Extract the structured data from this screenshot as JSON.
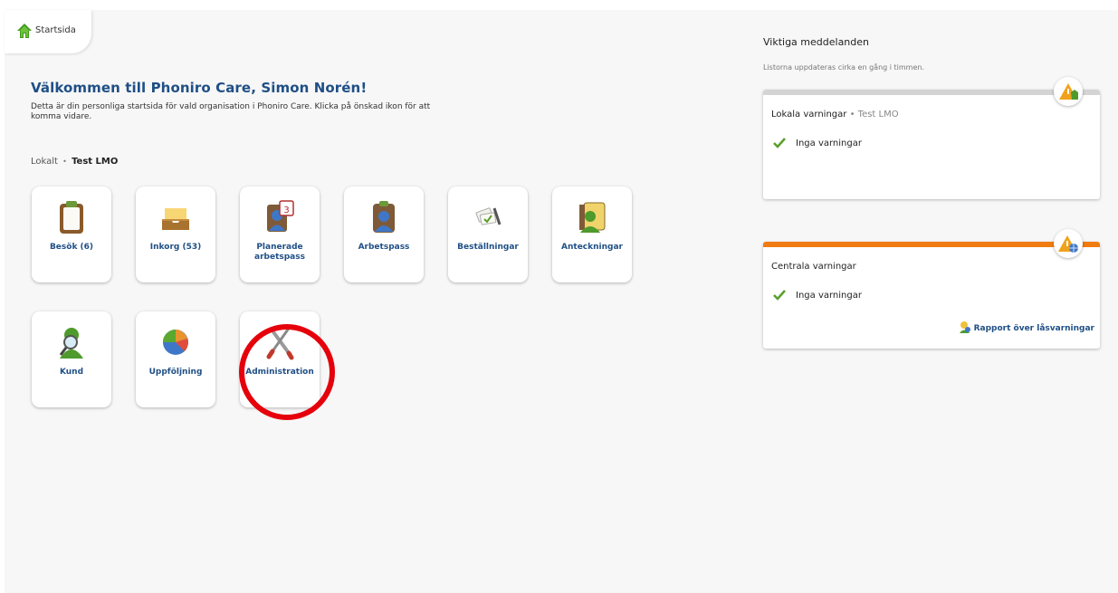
{
  "nav": {
    "start_tab": "Startsida"
  },
  "welcome": {
    "title": "Välkommen till Phoniro Care, Simon Norén!",
    "description": "Detta är din personliga startsida för vald organisation i Phoniro Care. Klicka på önskad ikon för att komma vidare."
  },
  "org": {
    "prefix": "Lokalt",
    "separator": "•",
    "name": "Test LMO"
  },
  "tiles": [
    {
      "label": "Besök (6)",
      "icon": "clipboard-icon"
    },
    {
      "label": "Inkorg (53)",
      "icon": "inbox-tray-icon"
    },
    {
      "label": "Planerade arbetspass",
      "icon": "calendar-person-icon"
    },
    {
      "label": "Arbetspass",
      "icon": "person-clipboard-icon"
    },
    {
      "label": "Beställningar",
      "icon": "order-cards-icon"
    },
    {
      "label": "Anteckningar",
      "icon": "notes-person-icon"
    },
    {
      "label": "Kund",
      "icon": "customer-search-icon"
    },
    {
      "label": "Uppföljning",
      "icon": "pie-chart-icon"
    },
    {
      "label": "Administration",
      "icon": "tools-icon"
    }
  ],
  "highlight": {
    "target": "Administration",
    "color": "#e6000b"
  },
  "messages": {
    "title": "Viktiga meddelanden",
    "subtitle": "Listorna uppdateras cirka en gång i timmen.",
    "local": {
      "title": "Lokala varningar",
      "separator": "•",
      "org": "Test LMO",
      "status": "Inga varningar",
      "bar_color": "#d4d4d4"
    },
    "central": {
      "title": "Centrala varningar",
      "status": "Inga varningar",
      "link": "Rapport över låsvarningar",
      "bar_color": "#f07c11"
    }
  },
  "colors": {
    "link_blue": "#1f4f86",
    "check_green": "#5a9e2c",
    "background": "#f7f7f7"
  }
}
